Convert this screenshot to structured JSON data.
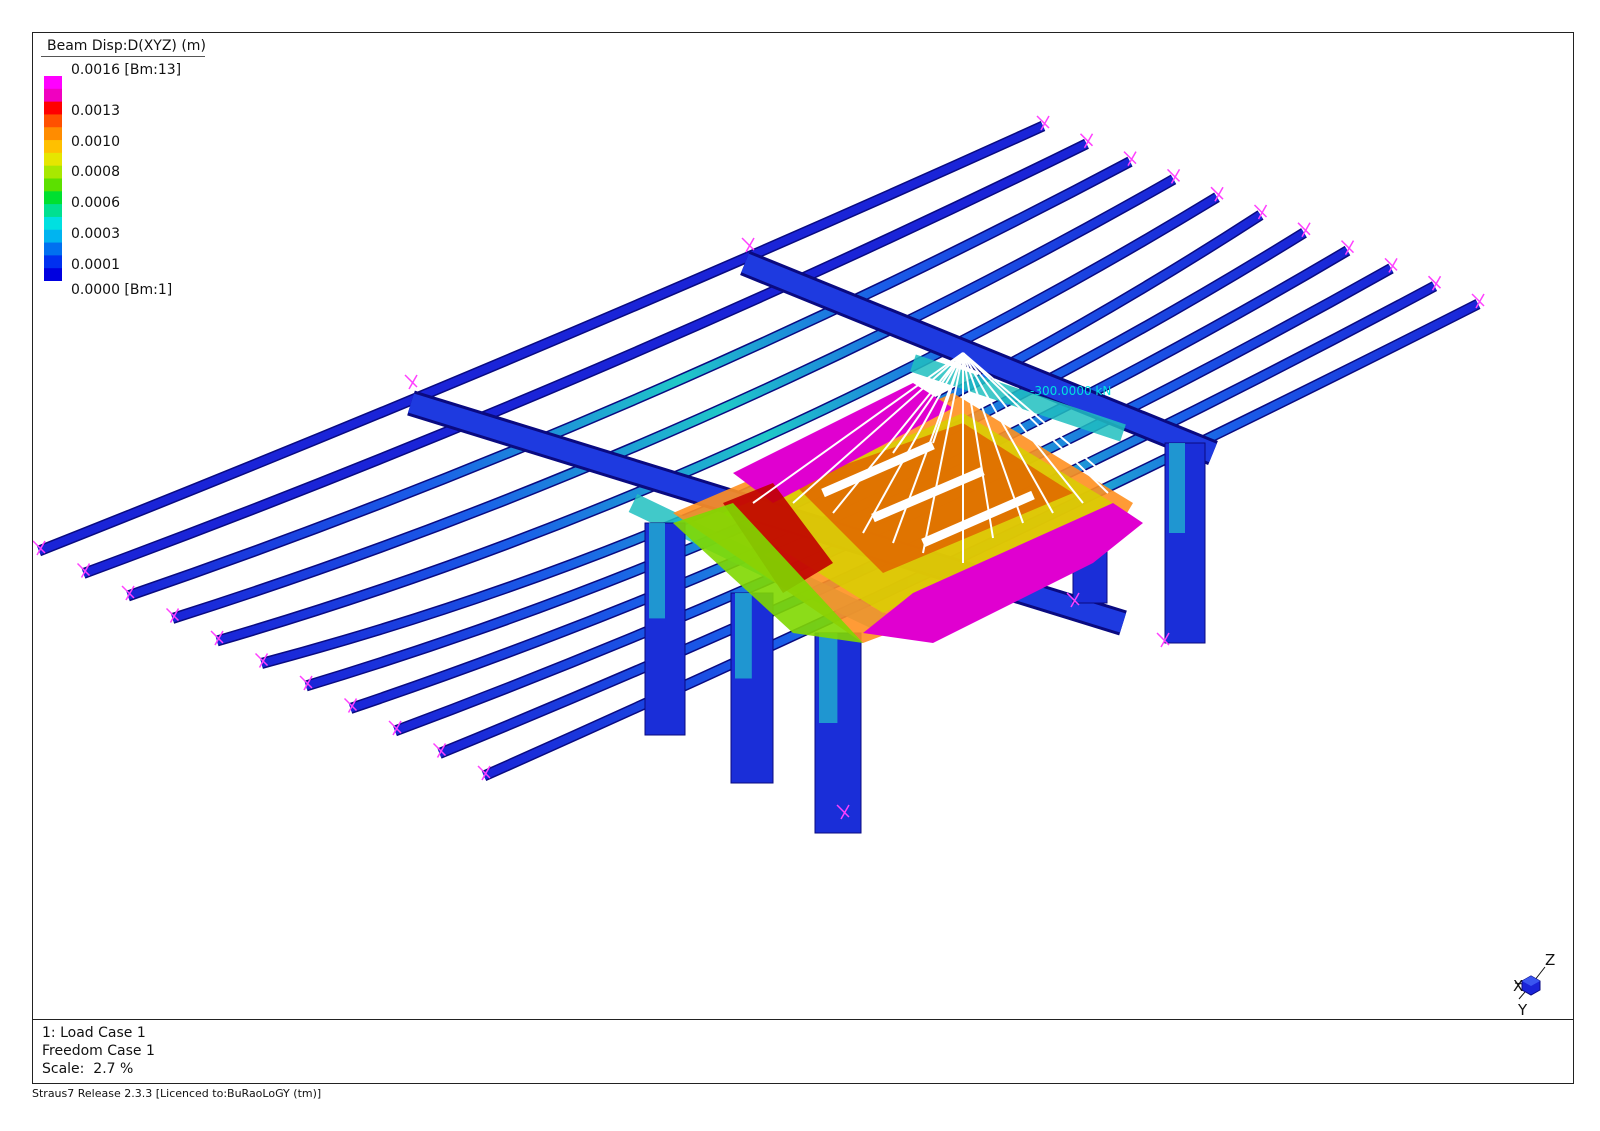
{
  "legend": {
    "title": "Beam Disp:D(XYZ) (m)",
    "max_label": "0.0016 [Bm:13]",
    "min_label": "0.0000 [Bm:1]",
    "ticks": [
      "0.0013",
      "0.0010",
      "0.0008",
      "0.0006",
      "0.0003",
      "0.0001"
    ],
    "colors": [
      "#ff00ff",
      "#f000c0",
      "#ff0000",
      "#ff5000",
      "#ff8c00",
      "#ffc000",
      "#e6e600",
      "#a8e800",
      "#5ce000",
      "#00e030",
      "#00e090",
      "#00e0e0",
      "#00b4f0",
      "#0070f0",
      "#0030f0",
      "#0000e0"
    ]
  },
  "model": {
    "load_label": "-300.0000 kN",
    "label_color": "#00e0e0",
    "support_color": "#ff40ff",
    "cable_color": "#ffffff"
  },
  "info": {
    "load_case": "1: Load Case 1",
    "freedom_case": "Freedom Case 1",
    "scale": "Scale:  2.7 %"
  },
  "triad": {
    "z": "Z",
    "x": "X",
    "y": "Y",
    "icon": "axis-triad-icon"
  },
  "credit": "Straus7 Release 2.3.3 [Licenced to:BuRaoLoGY (tm)]"
}
